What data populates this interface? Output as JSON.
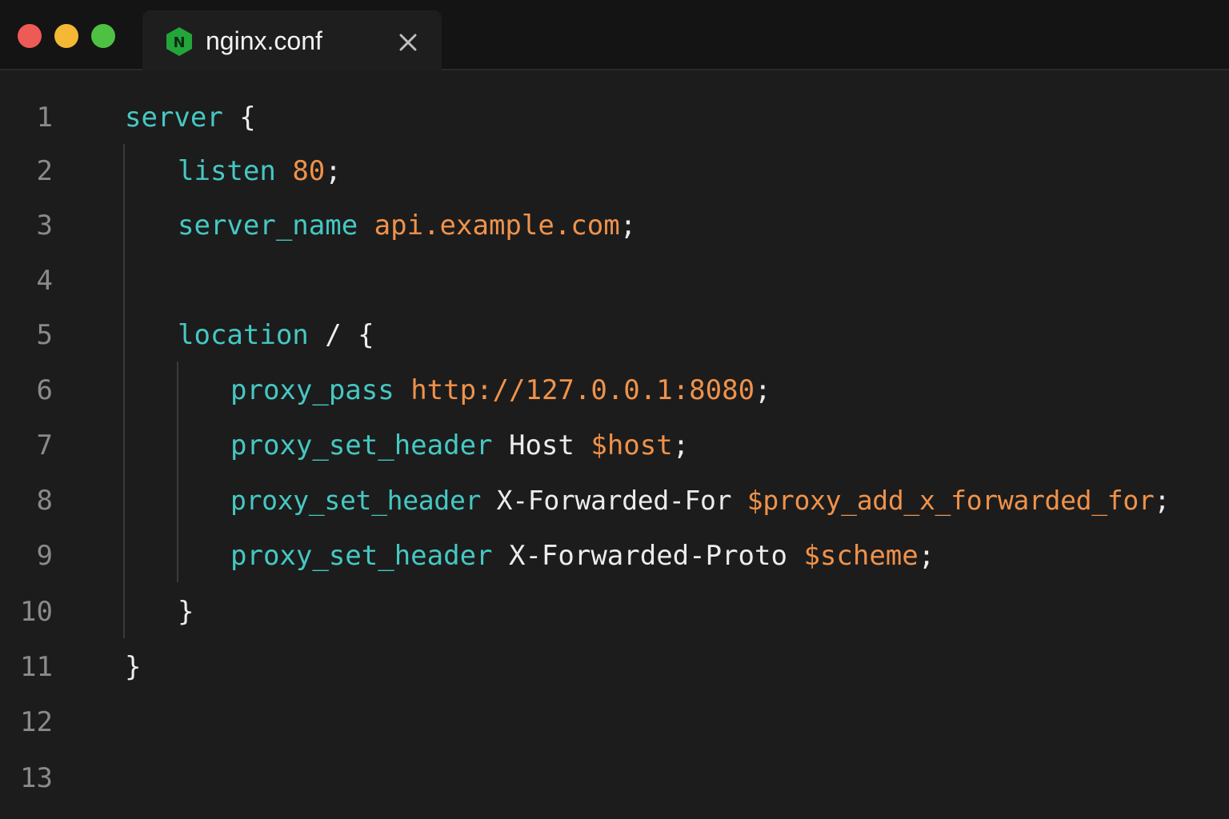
{
  "window": {
    "traffic_lights": {
      "close_color": "#ee5a55",
      "minimize_color": "#f5b834",
      "maximize_color": "#4ec142"
    }
  },
  "tab": {
    "title": "nginx.conf",
    "icon": "nginx-icon",
    "icon_letter": "N",
    "icon_color": "#22a63a",
    "close_icon": "close-icon"
  },
  "editor": {
    "line_numbers": [
      "1",
      "2",
      "3",
      "4",
      "5",
      "6",
      "7",
      "8",
      "9",
      "10",
      "11",
      "12",
      "13"
    ],
    "lines": {
      "l1": {
        "kw": "server",
        "punct": " {"
      },
      "l2": {
        "kw": "listen",
        "val": "80",
        "punct": ";"
      },
      "l3": {
        "kw": "server_name",
        "val": "api.example.com",
        "punct": ";"
      },
      "l5": {
        "kw": "location",
        "plain": " / {"
      },
      "l6": {
        "kw": "proxy_pass",
        "val": "http://127.0.0.1:8080",
        "punct": ";"
      },
      "l7": {
        "kw": "proxy_set_header",
        "plain": " Host ",
        "val": "$host",
        "punct": ";"
      },
      "l8": {
        "kw": "proxy_set_header",
        "plain": " X-Forwarded-For ",
        "val": "$proxy_add_x_forwarded_for",
        "punct": ";"
      },
      "l9": {
        "kw": "proxy_set_header",
        "plain": " X-Forwarded-Proto ",
        "val": "$scheme",
        "punct": ";"
      },
      "l10": {
        "punct": "}"
      },
      "l11": {
        "punct": "}"
      }
    },
    "colors": {
      "keyword": "#45c8c3",
      "value": "#f0924a",
      "text": "#ececec",
      "line_number": "#8a8a8a"
    }
  }
}
